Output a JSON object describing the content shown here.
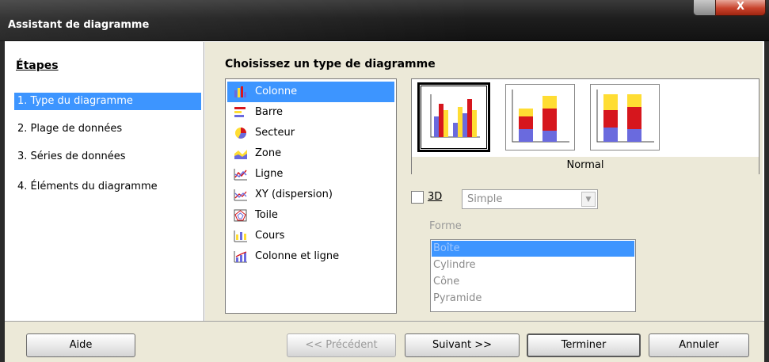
{
  "window": {
    "title": "Assistant de diagramme",
    "close_glyph": "X"
  },
  "steps": {
    "header": "Étapes",
    "items": [
      {
        "label": "1.  Type du diagramme",
        "active": true
      },
      {
        "label": "2.  Plage de données",
        "active": false
      },
      {
        "label": "3.  Séries de données",
        "active": false
      },
      {
        "label": "4.  Éléments du diagramme",
        "active": false
      }
    ]
  },
  "main": {
    "title": "Choisissez un type de diagramme",
    "types": [
      {
        "label": "Colonne",
        "icon": "column-chart-icon",
        "selected": true
      },
      {
        "label": "Barre",
        "icon": "bar-chart-icon",
        "selected": false
      },
      {
        "label": "Secteur",
        "icon": "pie-chart-icon",
        "selected": false
      },
      {
        "label": "Zone",
        "icon": "area-chart-icon",
        "selected": false
      },
      {
        "label": "Ligne",
        "icon": "line-chart-icon",
        "selected": false
      },
      {
        "label": "XY (dispersion)",
        "icon": "scatter-chart-icon",
        "selected": false
      },
      {
        "label": "Toile",
        "icon": "net-chart-icon",
        "selected": false
      },
      {
        "label": "Cours",
        "icon": "stock-chart-icon",
        "selected": false
      },
      {
        "label": "Colonne et ligne",
        "icon": "column-line-chart-icon",
        "selected": false
      }
    ],
    "variant_caption": "Normal",
    "three_d_label": "3D",
    "shape_select_value": "Simple",
    "forme_label": "Forme",
    "forme_items": [
      "Boîte",
      "Cylindre",
      "Cône",
      "Pyramide"
    ]
  },
  "buttons": {
    "help": "Aide",
    "previous": "<< Précédent",
    "next": "Suivant >>",
    "finish": "Terminer",
    "cancel": "Annuler"
  },
  "colors": {
    "selection": "#3d95ff",
    "bar_red": "#d6161d",
    "bar_yellow": "#ffdd33",
    "bar_blue": "#6a6ade"
  }
}
